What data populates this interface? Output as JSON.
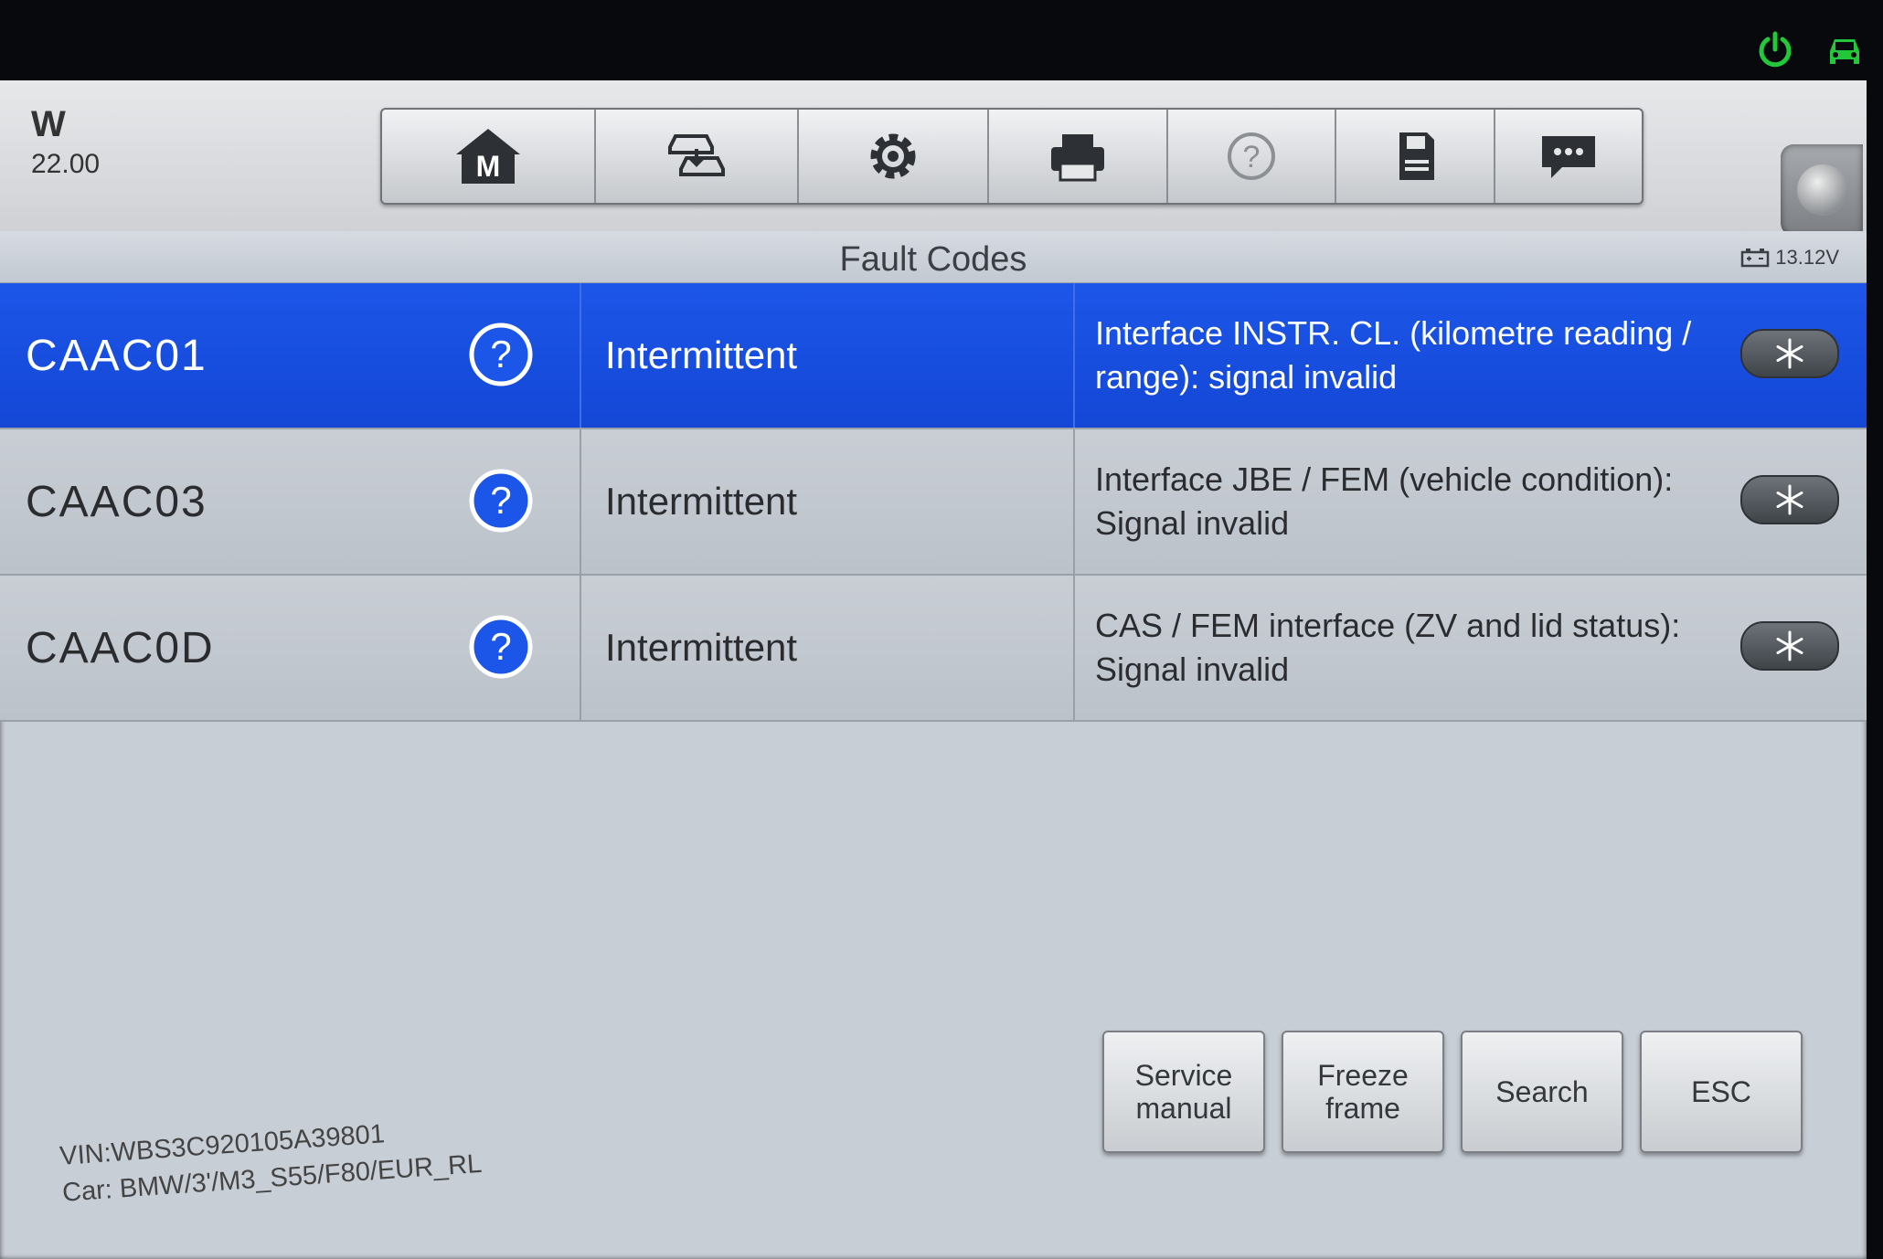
{
  "brand": {
    "name": "W",
    "version": "22.00"
  },
  "screen": {
    "title": "Fault Codes",
    "voltage": "13.12V"
  },
  "toolbar": [
    {
      "icon": "home-m-icon",
      "letter": "M"
    },
    {
      "icon": "vehicle-swap-icon"
    },
    {
      "icon": "settings-gear-icon"
    },
    {
      "icon": "printer-icon"
    },
    {
      "icon": "help-icon"
    },
    {
      "icon": "save-disk-icon"
    },
    {
      "icon": "message-icon"
    }
  ],
  "faults": [
    {
      "code": "CAAC01",
      "status": "Intermittent",
      "description": "Interface INSTR. CL. (kilometre reading / range): signal invalid",
      "selected": true
    },
    {
      "code": "CAAC03",
      "status": "Intermittent",
      "description": "Interface JBE / FEM (vehicle condition): Signal invalid",
      "selected": false
    },
    {
      "code": "CAAC0D",
      "status": "Intermittent",
      "description": "CAS / FEM interface (ZV and lid status): Signal invalid",
      "selected": false
    }
  ],
  "vehicle": {
    "vin": "VIN:WBS3C920105A39801",
    "car": "Car: BMW/3'/M3_S55/F80/EUR_RL"
  },
  "actions": {
    "service_manual": "Service\nmanual",
    "freeze_frame": "Freeze\nframe",
    "search": "Search",
    "esc": "ESC"
  },
  "colors": {
    "status_green": "#22c83a",
    "selection_blue": "#1a4fe2"
  }
}
